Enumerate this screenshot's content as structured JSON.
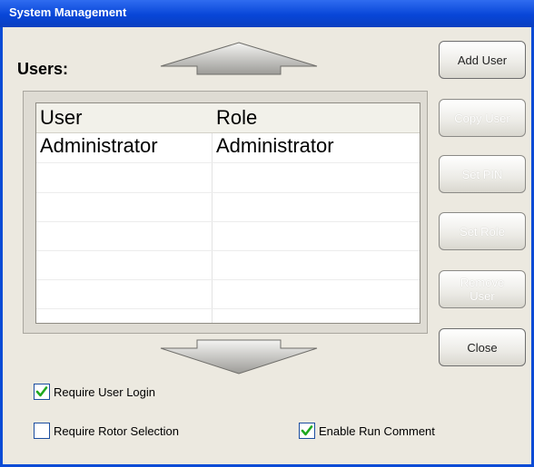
{
  "window": {
    "title": "System Management"
  },
  "users_label": "Users:",
  "table": {
    "headers": [
      "User",
      "Role"
    ],
    "rows": [
      [
        "Administrator",
        "Administrator"
      ]
    ]
  },
  "buttons": {
    "add_user": "Add User",
    "copy_user": "Copy User",
    "set_pin": "Set PIN",
    "set_role": "Set Role",
    "remove_user": "Remove User",
    "close": "Close"
  },
  "options": {
    "require_user_login": {
      "label": "Require User Login",
      "checked": true
    },
    "require_rotor_selection": {
      "label": "Require Rotor Selection",
      "checked": false
    },
    "enable_run_comment": {
      "label": "Enable Run Comment",
      "checked": true
    }
  },
  "colors": {
    "titlebar": "#0846d8",
    "check": "#1fa81f"
  }
}
